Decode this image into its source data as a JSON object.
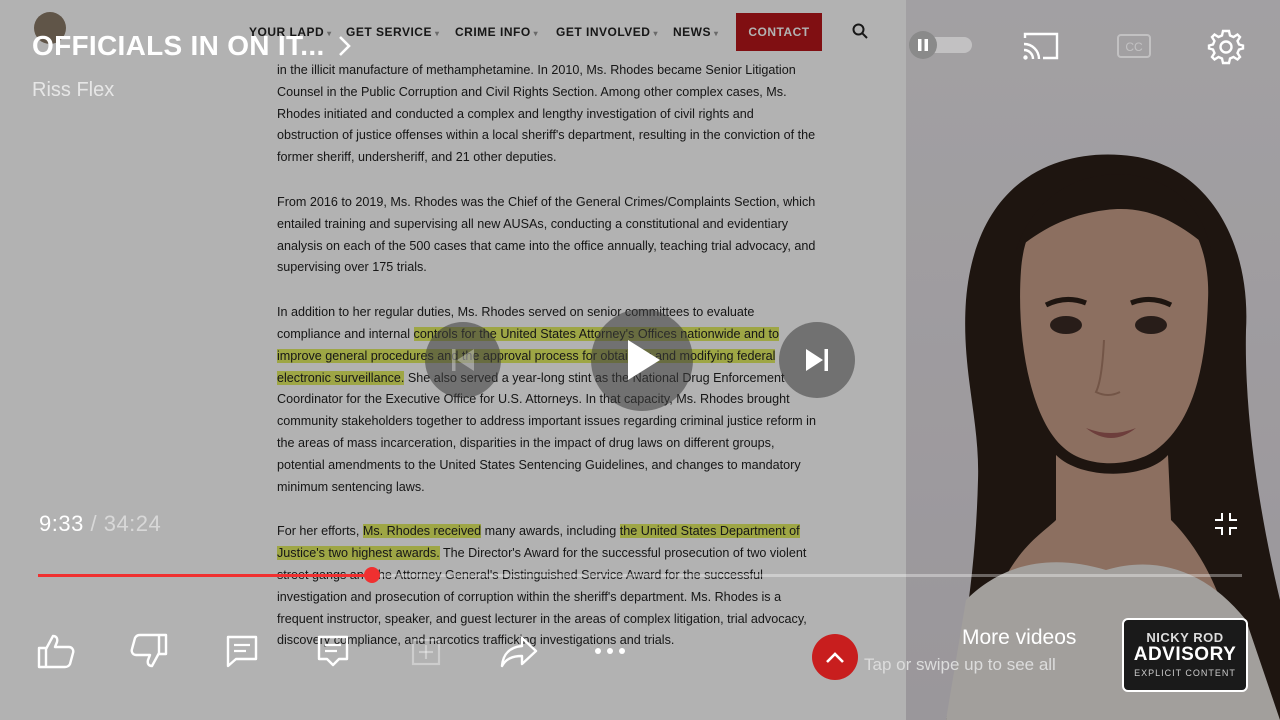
{
  "video": {
    "title": "OFFICIALS IN ON IT...",
    "channel": "Riss Flex",
    "current_time": "9:33",
    "separator": "/",
    "duration": "34:24",
    "progress": 0.277
  },
  "website": {
    "nav": [
      "YOUR LAPD",
      "GET SERVICE",
      "CRIME INFO",
      "GET INVOLVED",
      "NEWS"
    ],
    "contact_label": "CONTACT",
    "paragraphs": [
      [
        "in the illicit manufacture of methamphetamine. In 2010, Ms. Rhodes became Senior Litigation Counsel in the Public Corruption and Civil Rights Section. Among other complex cases, Ms. Rhodes initiated and conducted a complex and lengthy investigation of civil rights and obstruction of justice offenses within a local sheriff's department, resulting in the conviction of the former sheriff, undersheriff, and 21 other deputies."
      ],
      [
        "From 2016 to 2019, Ms. Rhodes was the Chief of the General Crimes/Complaints Section, which entailed training and supervising all new AUSAs, conducting a constitutional and evidentiary analysis on each of the 500 cases that came into the office annually, teaching trial advocacy, and supervising over 175 trials."
      ],
      [
        "In addition to her regular duties, Ms. Rhodes served on senior committees to evaluate compliance and internal ",
        "controls for the United States Attorney's Offices nationwide and to improve general procedures and the approval process for obtaining and modifying federal electronic surveillance.",
        " She also served a year-long stint as the National Drug Enforcement Coordinator for the Executive Office for U.S. Attorneys. In that capacity, Ms. Rhodes brought community stakeholders together to address important issues regarding criminal justice reform in the areas of mass incarceration, disparities in the impact of drug laws on different groups, potential amendments to the United States Sentencing Guidelines, and changes to mandatory minimum sentencing laws."
      ],
      [
        "For her efforts, ",
        "Ms. Rhodes received",
        " many awards, including ",
        "the United States Department of Justice's two highest awards.",
        " The Director's Award for the successful prosecution of two violent street gangs and the Attorney General's Distinguished Service Award for the successful investigation and prosecution of corruption within the sheriff's department. Ms. Rhodes is a frequent instructor, speaker, and guest lecturer in the areas of complex litigation, trial advocacy, discovery compliance, and narcotics trafficking investigations and trials."
      ]
    ]
  },
  "end_panel": {
    "more_videos": "More videos",
    "hint": "Tap or swipe up to see all",
    "thumb_top": "NICKY ROD",
    "thumb_main": "ADVISORY",
    "thumb_sub": "EXPLICIT CONTENT"
  },
  "colors": {
    "accent_red": "#f03030",
    "contact_red": "#b8161b",
    "highlight": "#e3ee64"
  },
  "icons": {
    "top": [
      "pause-icon",
      "cast-icon",
      "captions-icon",
      "settings-icon"
    ],
    "actions": [
      "like-icon",
      "dislike-icon",
      "comments-icon",
      "chat-icon",
      "save-icon",
      "share-icon",
      "more-icon"
    ]
  }
}
